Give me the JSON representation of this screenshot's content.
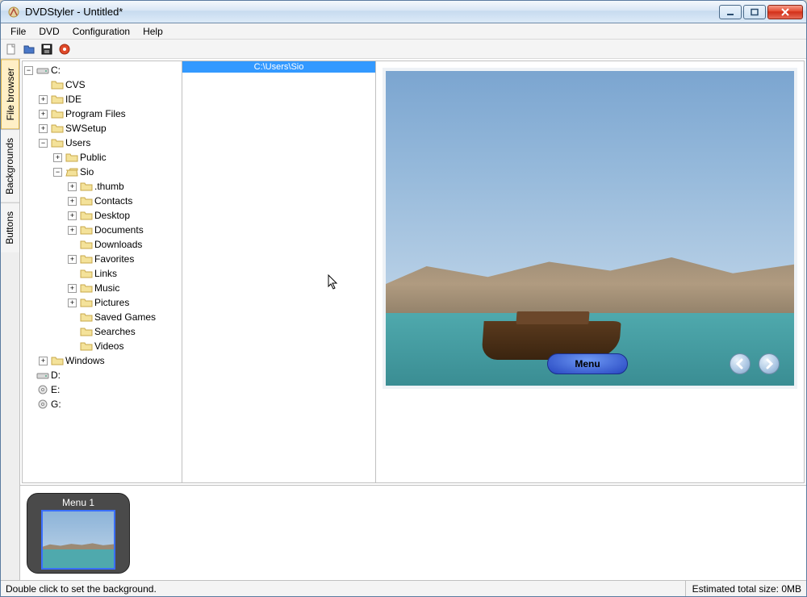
{
  "window": {
    "title": "DVDStyler - Untitled*"
  },
  "menu": {
    "items": [
      "File",
      "DVD",
      "Configuration",
      "Help"
    ]
  },
  "side_tabs": {
    "file_browser": "File browser",
    "backgrounds": "Backgrounds",
    "buttons": "Buttons"
  },
  "path_bar": "C:\\Users\\Sio",
  "tree": {
    "drives": {
      "C": "C:",
      "D": "D:",
      "E": "E:",
      "G": "G:"
    },
    "c_children": {
      "cvs": "CVS",
      "ide": "IDE",
      "program_files": "Program Files",
      "swsetup": "SWSetup",
      "users": "Users",
      "windows": "Windows"
    },
    "users_children": {
      "public": "Public",
      "sio": "Sio"
    },
    "sio_children": {
      "thumb": ".thumb",
      "contacts": "Contacts",
      "desktop": "Desktop",
      "documents": "Documents",
      "downloads": "Downloads",
      "favorites": "Favorites",
      "links": "Links",
      "music": "Music",
      "pictures": "Pictures",
      "saved_games": "Saved Games",
      "searches": "Searches",
      "videos": "Videos"
    }
  },
  "preview": {
    "menu_button": "Menu"
  },
  "menu_strip": {
    "label": "Menu 1"
  },
  "status": {
    "left": "Double click to set the background.",
    "right": "Estimated total size: 0MB"
  }
}
